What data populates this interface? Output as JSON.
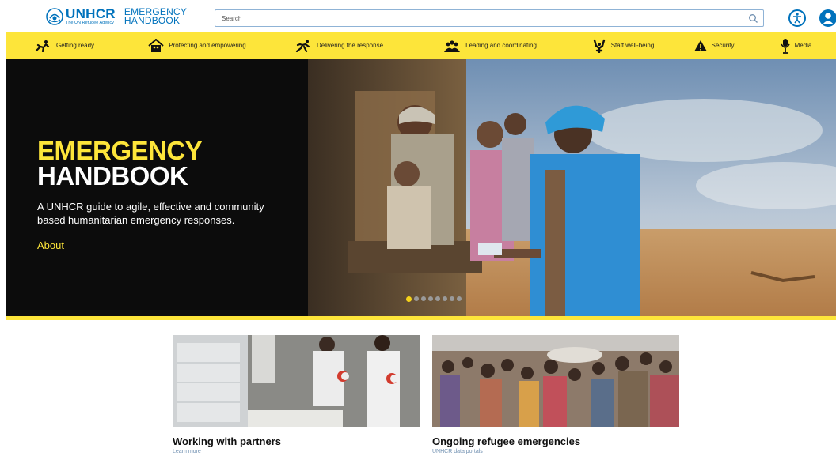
{
  "header": {
    "logo_unhcr": "UNHCR",
    "logo_agency": "The UN Refugee Agency",
    "logo_title_line1": "EMERGENCY",
    "logo_title_line2": "HANDBOOK",
    "search_placeholder": "Search",
    "accessibility_icon": "accessibility-icon",
    "user_icon": "user-account-icon",
    "brand_blue": "#0072bc"
  },
  "nav": {
    "accent": "#fde53a",
    "items": [
      {
        "label": "Getting ready",
        "icon": "runner-start-icon"
      },
      {
        "label": "Protecting and empowering",
        "icon": "family-shelter-icon"
      },
      {
        "label": "Delivering the response",
        "icon": "running-person-icon"
      },
      {
        "label": "Leading and coordinating",
        "icon": "group-people-icon"
      },
      {
        "label": "Staff well-being",
        "icon": "raised-hands-icon"
      },
      {
        "label": "Security",
        "icon": "warning-triangle-icon"
      },
      {
        "label": "Media",
        "icon": "microphone-icon"
      }
    ]
  },
  "hero": {
    "title_line1": "EMERGENCY",
    "title_line2": "HANDBOOK",
    "description": "A UNHCR guide to agile, effective and community based humanitarian emergency responses.",
    "about_link": "About",
    "slide_count": 8,
    "active_slide": 1
  },
  "cards": [
    {
      "title": "Working with partners",
      "subtitle": "Learn more"
    },
    {
      "title": "Ongoing refugee emergencies",
      "subtitle": "UNHCR data portals"
    }
  ]
}
